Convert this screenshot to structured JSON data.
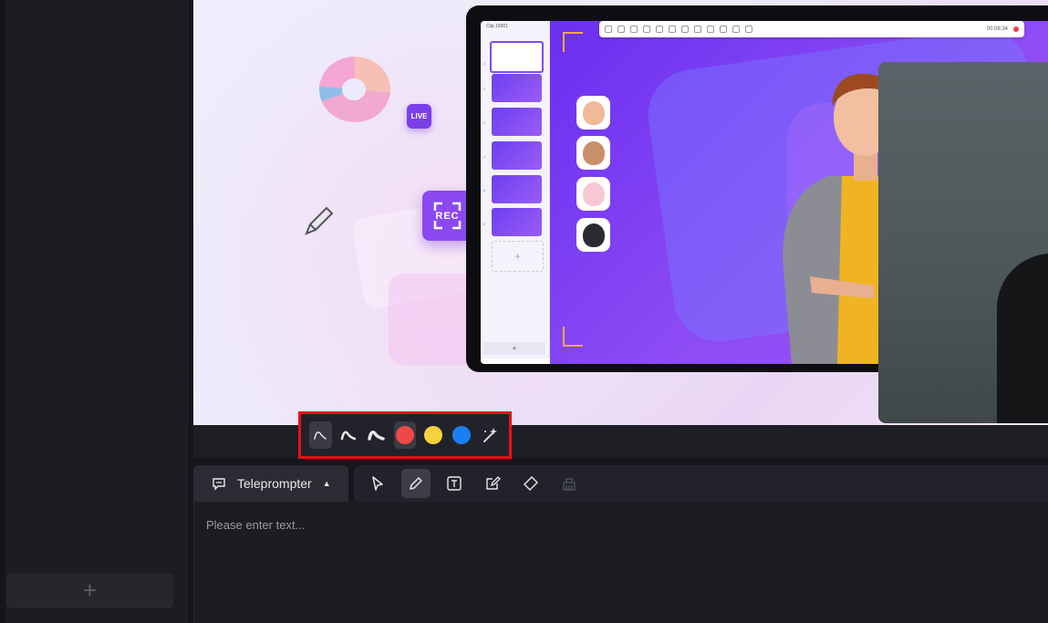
{
  "left_panel": {
    "add_label": "+"
  },
  "preview": {
    "live_badge": "LIVE",
    "rec_badge": "REC",
    "app_title": "Clip 10001",
    "timer": "00:08:34",
    "thumb_numbers": [
      "1",
      "2",
      "3",
      "4",
      "5",
      "6"
    ],
    "thumb_add_label": "+",
    "thumb_bottom_add_label": "+"
  },
  "pen_toolbar": {
    "tools": [
      {
        "name": "pen-thin",
        "icon": "pen-thin-icon"
      },
      {
        "name": "pen-medium",
        "icon": "pen-medium-icon"
      },
      {
        "name": "pen-thick",
        "icon": "pen-thick-icon"
      }
    ],
    "colors": [
      "#f04848",
      "#f6d23c",
      "#1a7ff0"
    ],
    "magic_icon": "magic-wand-icon"
  },
  "teleprompter": {
    "tab_label": "Teleprompter",
    "placeholder": "Please enter text..."
  },
  "draw_tools": [
    "pointer-icon",
    "pencil-icon",
    "text-icon",
    "edit-box-icon",
    "eraser-icon",
    "clear-icon"
  ],
  "colors": {
    "accent": "#7b3fe8",
    "highlight": "#e8101a"
  }
}
